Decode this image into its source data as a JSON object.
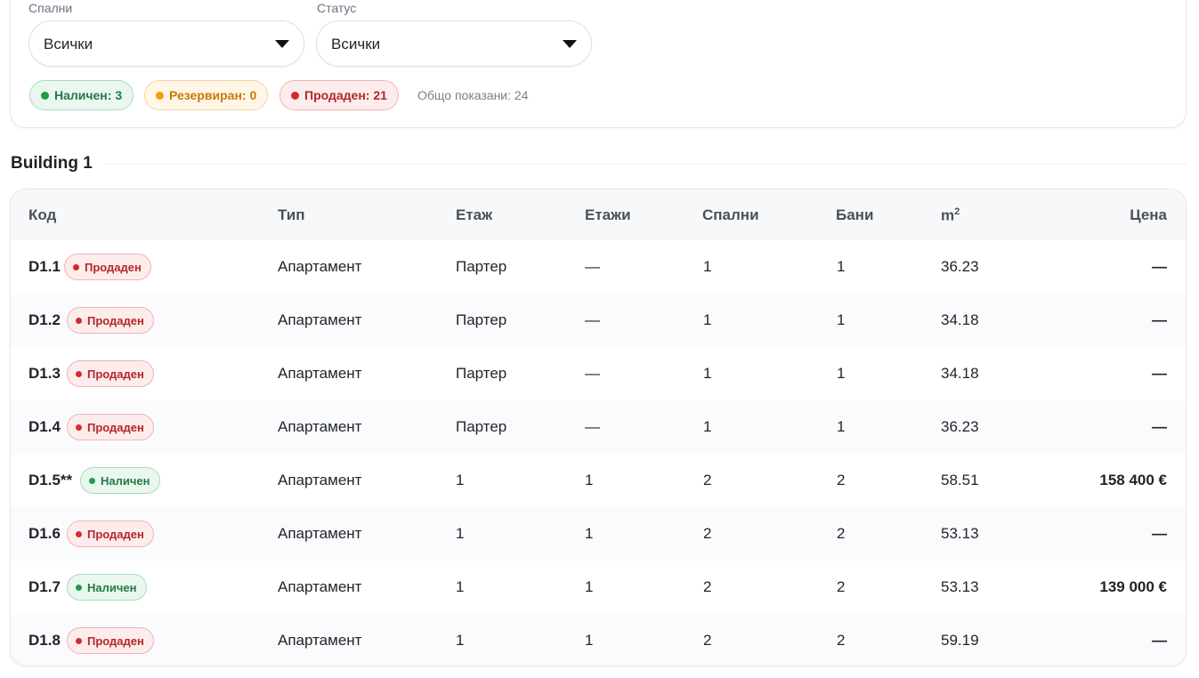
{
  "filters": {
    "bedrooms": {
      "label": "Спални",
      "value": "Всички"
    },
    "status": {
      "label": "Статус",
      "value": "Всички"
    },
    "summary": {
      "available": "Наличен: 3",
      "reserved": "Резервиран: 0",
      "sold": "Продаден: 21",
      "total": "Общо показани: 24"
    }
  },
  "colors": {
    "available": "#1f9d4d",
    "reserved": "#f29d12",
    "sold": "#d42a2f"
  },
  "section": {
    "title": "Building 1"
  },
  "table": {
    "headers": {
      "code": "Код",
      "type": "Тип",
      "floor": "Етаж",
      "floors": "Етажи",
      "bedrooms": "Спални",
      "baths": "Бани",
      "area": "m",
      "area_sup": "2",
      "price": "Цена"
    },
    "rows": [
      {
        "code": "D1.1",
        "status": "sold",
        "status_label": "Продаден",
        "type": "Апартамент",
        "floor": "Партер",
        "floors": "—",
        "bedrooms": "1",
        "baths": "1",
        "area": "36.23",
        "price": "—"
      },
      {
        "code": "D1.2",
        "status": "sold",
        "status_label": "Продаден",
        "type": "Апартамент",
        "floor": "Партер",
        "floors": "—",
        "bedrooms": "1",
        "baths": "1",
        "area": "34.18",
        "price": "—"
      },
      {
        "code": "D1.3",
        "status": "sold",
        "status_label": "Продаден",
        "type": "Апартамент",
        "floor": "Партер",
        "floors": "—",
        "bedrooms": "1",
        "baths": "1",
        "area": "34.18",
        "price": "—"
      },
      {
        "code": "D1.4",
        "status": "sold",
        "status_label": "Продаден",
        "type": "Апартамент",
        "floor": "Партер",
        "floors": "—",
        "bedrooms": "1",
        "baths": "1",
        "area": "36.23",
        "price": "—"
      },
      {
        "code": "D1.5**",
        "status": "available",
        "status_label": "Наличен",
        "type": "Апартамент",
        "floor": "1",
        "floors": "1",
        "bedrooms": "2",
        "baths": "2",
        "area": "58.51",
        "price": "158 400 €"
      },
      {
        "code": "D1.6",
        "status": "sold",
        "status_label": "Продаден",
        "type": "Апартамент",
        "floor": "1",
        "floors": "1",
        "bedrooms": "2",
        "baths": "2",
        "area": "53.13",
        "price": "—"
      },
      {
        "code": "D1.7",
        "status": "available",
        "status_label": "Наличен",
        "type": "Апартамент",
        "floor": "1",
        "floors": "1",
        "bedrooms": "2",
        "baths": "2",
        "area": "53.13",
        "price": "139 000 €"
      },
      {
        "code": "D1.8",
        "status": "sold",
        "status_label": "Продаден",
        "type": "Апартамент",
        "floor": "1",
        "floors": "1",
        "bedrooms": "2",
        "baths": "2",
        "area": "59.19",
        "price": "—"
      }
    ]
  }
}
